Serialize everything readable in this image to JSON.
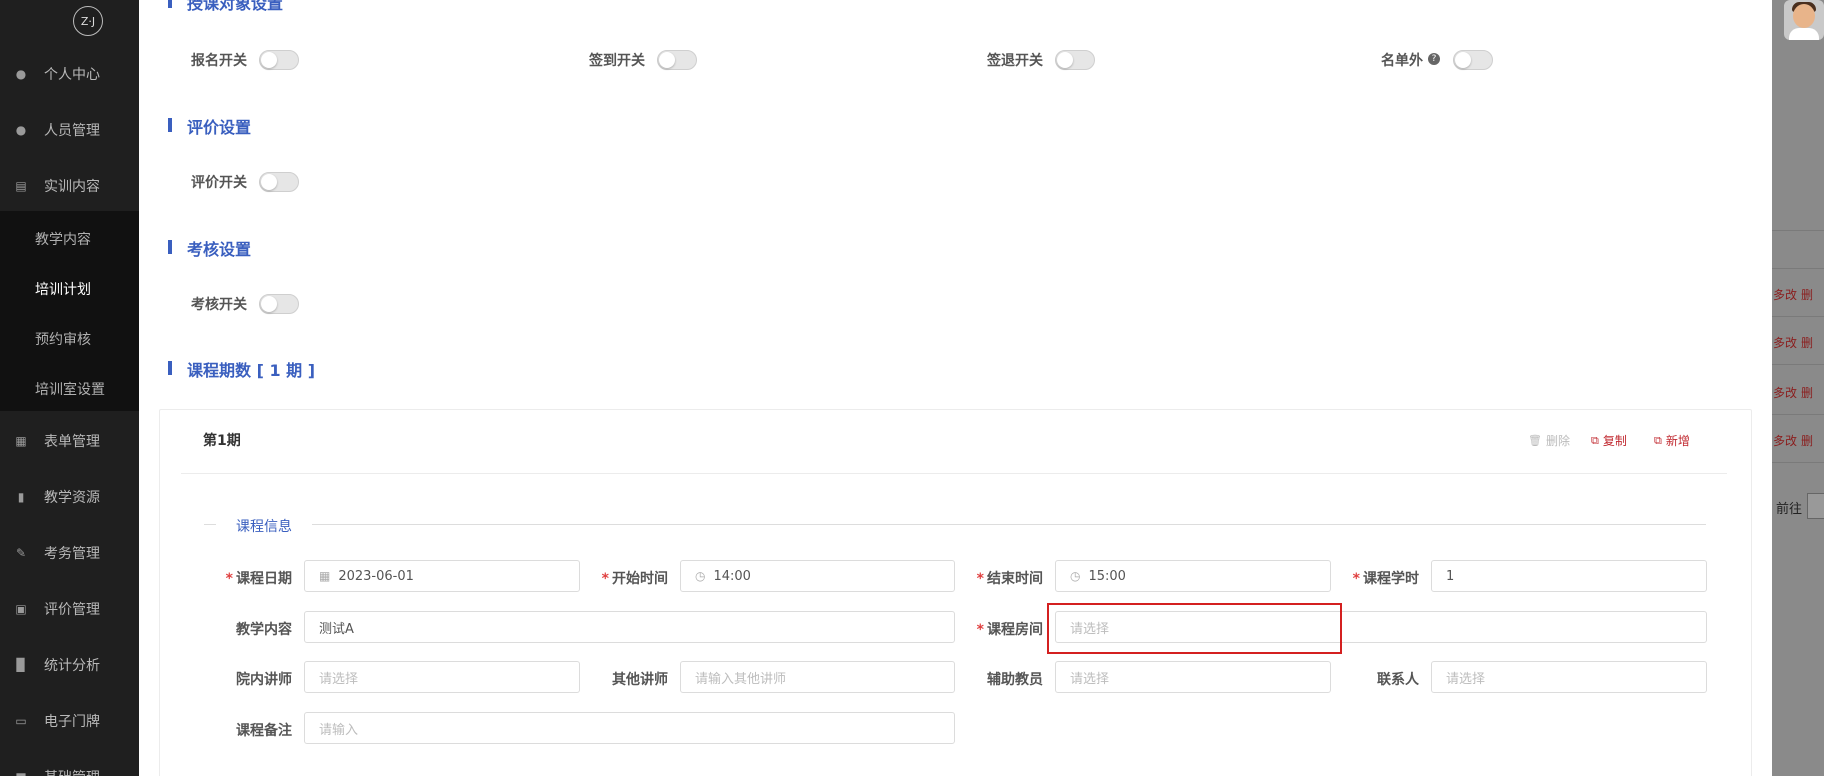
{
  "sidebar": {
    "logo_text": "Z·J",
    "items": [
      {
        "label": "个人中心",
        "icon": "user-icon"
      },
      {
        "label": "人员管理",
        "icon": "users-icon"
      },
      {
        "label": "实训内容",
        "icon": "book-icon"
      },
      {
        "label": "表单管理",
        "icon": "form-icon"
      },
      {
        "label": "教学资源",
        "icon": "resource-icon"
      },
      {
        "label": "考务管理",
        "icon": "edit-icon"
      },
      {
        "label": "评价管理",
        "icon": "rating-icon"
      },
      {
        "label": "统计分析",
        "icon": "bar-chart-icon"
      },
      {
        "label": "电子门牌",
        "icon": "monitor-icon"
      },
      {
        "label": "基础管理",
        "icon": "settings-icon"
      }
    ],
    "subitems": [
      {
        "label": "教学内容",
        "active": false
      },
      {
        "label": "培训计划",
        "active": true
      },
      {
        "label": "预约审核",
        "active": false
      },
      {
        "label": "培训室设置",
        "active": false
      }
    ]
  },
  "sections": {
    "target": "授课对象设置",
    "evaluation": "评价设置",
    "assessment": "考核设置",
    "periods": "课程期数 [ 1 期 ]"
  },
  "switches": {
    "signup": {
      "label": "报名开关",
      "on": false
    },
    "checkin": {
      "label": "签到开关",
      "on": false
    },
    "checkout": {
      "label": "签退开关",
      "on": false
    },
    "whitelist": {
      "label": "名单外",
      "on": false
    },
    "evaluation": {
      "label": "评价开关",
      "on": false
    },
    "assessment": {
      "label": "考核开关",
      "on": false
    }
  },
  "period": {
    "title": "第1期",
    "actions": {
      "delete": "删除",
      "copy": "复制",
      "add": "新增"
    },
    "group_title": "课程信息"
  },
  "form": {
    "course_date": {
      "label": "课程日期",
      "value": "2023-06-01",
      "required": "*"
    },
    "start_time": {
      "label": "开始时间",
      "value": "14:00",
      "required": "*"
    },
    "end_time": {
      "label": "结束时间",
      "value": "15:00",
      "required": "*"
    },
    "course_hours": {
      "label": "课程学时",
      "value": "1",
      "required": "*"
    },
    "teaching_content": {
      "label": "教学内容",
      "value": "测试A"
    },
    "course_room": {
      "label": "课程房间",
      "placeholder": "请选择",
      "required": "*"
    },
    "internal_lecturer": {
      "label": "院内讲师",
      "placeholder": "请选择"
    },
    "other_lecturer": {
      "label": "其他讲师",
      "placeholder": "请输入其他讲师"
    },
    "assistant": {
      "label": "辅助教员",
      "placeholder": "请选择"
    },
    "contact": {
      "label": "联系人",
      "placeholder": "请选择"
    },
    "remark": {
      "label": "课程备注",
      "placeholder": "请输入"
    }
  },
  "overlay": {
    "row_edit": "多改",
    "row_delete": "删",
    "goto_label": "前往"
  },
  "colors": {
    "accent": "#3a5fbf",
    "danger": "#c0282f",
    "sidebar_bg": "#1f1f1f"
  }
}
